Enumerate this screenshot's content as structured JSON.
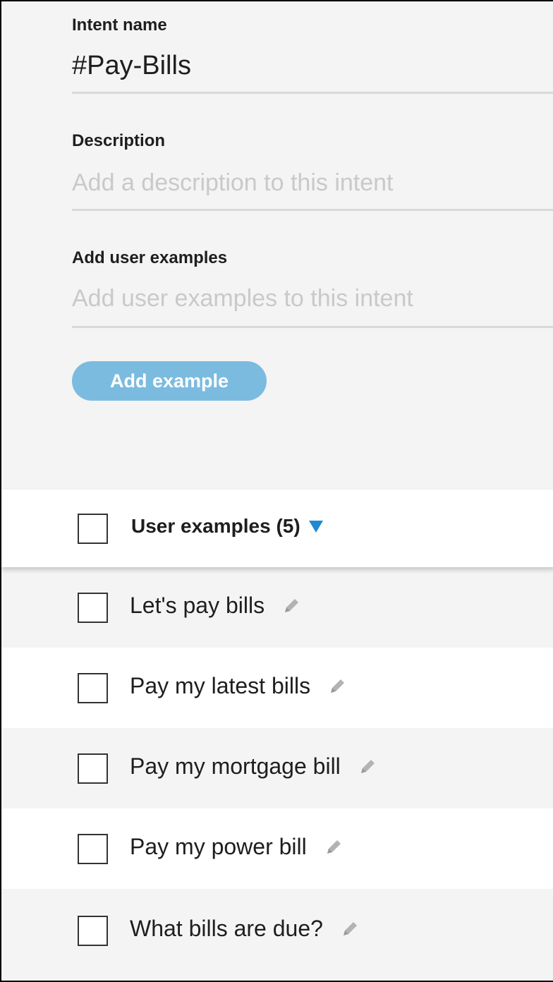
{
  "form": {
    "intent_name_label": "Intent name",
    "intent_name_value": "#Pay-Bills",
    "description_label": "Description",
    "description_placeholder": "Add a description to this intent",
    "examples_label": "Add user examples",
    "examples_placeholder": "Add user examples to this intent",
    "add_button": "Add example"
  },
  "list": {
    "header_title": "User examples (5)",
    "sort_icon": "caret-down-icon",
    "accent_color": "#1f8ad1",
    "rows": [
      {
        "text": "Let's pay bills",
        "icon": "pencil-icon"
      },
      {
        "text": "Pay my latest bills",
        "icon": "pencil-icon"
      },
      {
        "text": "Pay my mortgage bill",
        "icon": "pencil-icon"
      },
      {
        "text": "Pay my power bill",
        "icon": "pencil-icon"
      },
      {
        "text": "What bills are due?",
        "icon": "pencil-icon"
      }
    ]
  }
}
